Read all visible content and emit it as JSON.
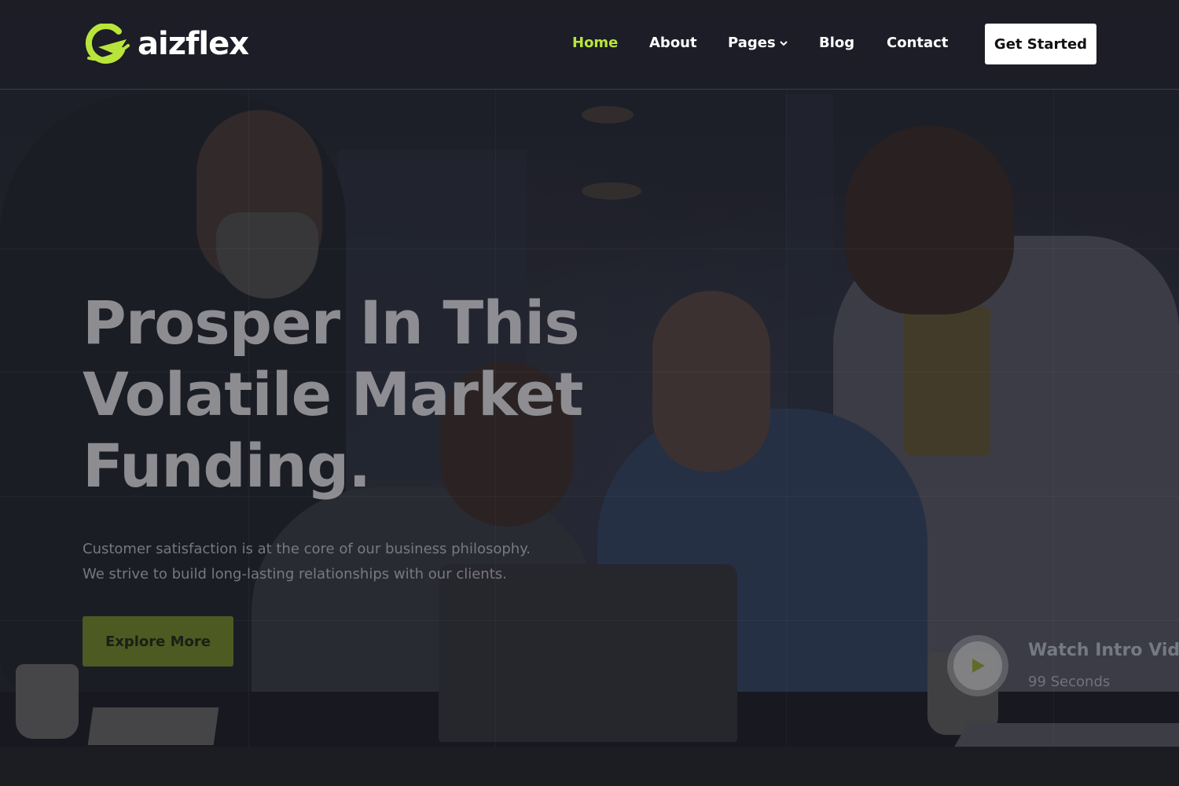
{
  "brand": {
    "name": "aizflex",
    "accent": "#b9e53b"
  },
  "nav": {
    "items": [
      {
        "label": "Home",
        "active": true
      },
      {
        "label": "About",
        "active": false
      },
      {
        "label": "Pages",
        "active": false,
        "has_dropdown": true
      },
      {
        "label": "Blog",
        "active": false
      },
      {
        "label": "Contact",
        "active": false
      }
    ],
    "cta_label": "Get Started"
  },
  "hero": {
    "title_lines": [
      "Prosper In This",
      "Volatile Market",
      "Funding."
    ],
    "subtitle_lines": [
      "Customer satisfaction is at the core of our business philosophy.",
      "We strive to build long-lasting relationships with our clients."
    ],
    "button_label": "Explore More",
    "video": {
      "title": "Watch Intro Video",
      "duration": "99 Seconds",
      "icon": "play-icon"
    }
  },
  "colors": {
    "header_bg": "#1c1d26",
    "cta_bg": "#ffffff",
    "explore_bg": "#4d5a22",
    "page_bg": "#1c1d22"
  }
}
